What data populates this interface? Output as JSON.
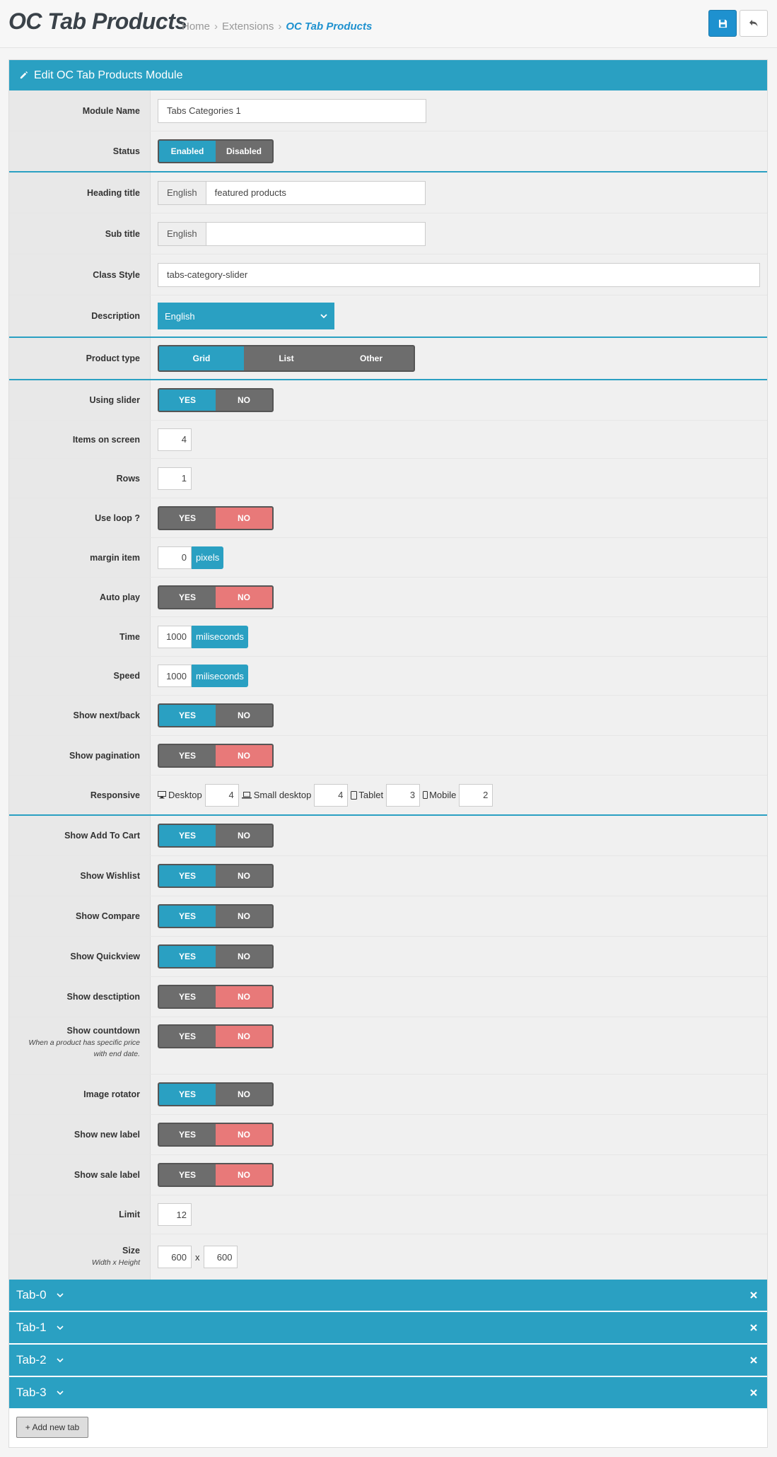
{
  "header": {
    "title": "OC Tab Products",
    "breadcrumb": [
      "Home",
      "Extensions",
      "OC Tab Products"
    ]
  },
  "panel": {
    "title": "Edit OC Tab Products Module"
  },
  "form": {
    "module_name": {
      "label": "Module Name",
      "value": "Tabs Categories 1"
    },
    "status": {
      "label": "Status",
      "on": "Enabled",
      "off": "Disabled"
    },
    "heading_title": {
      "label": "Heading title",
      "lang": "English",
      "value": "featured products"
    },
    "sub_title": {
      "label": "Sub title",
      "lang": "English",
      "value": ""
    },
    "class_style": {
      "label": "Class Style",
      "value": "tabs-category-slider"
    },
    "description": {
      "label": "Description",
      "selected": "English"
    },
    "product_type": {
      "label": "Product type",
      "options": [
        "Grid",
        "List",
        "Other"
      ]
    },
    "using_slider": {
      "label": "Using slider"
    },
    "items_on_screen": {
      "label": "Items on screen",
      "value": "4"
    },
    "rows": {
      "label": "Rows",
      "value": "1"
    },
    "use_loop": {
      "label": "Use loop ?"
    },
    "margin_item": {
      "label": "margin item",
      "value": "0",
      "unit": "pixels"
    },
    "auto_play": {
      "label": "Auto play"
    },
    "time": {
      "label": "Time",
      "value": "1000",
      "unit": "miliseconds"
    },
    "speed": {
      "label": "Speed",
      "value": "1000",
      "unit": "miliseconds"
    },
    "show_next_back": {
      "label": "Show next/back"
    },
    "show_pagination": {
      "label": "Show pagination"
    },
    "responsive": {
      "label": "Responsive",
      "desktop_label": "Desktop",
      "desktop": "4",
      "small_desktop_label": "Small desktop",
      "small_desktop": "4",
      "tablet_label": "Tablet",
      "tablet": "3",
      "mobile_label": "Mobile",
      "mobile": "2"
    },
    "show_add_to_cart": {
      "label": "Show Add To Cart"
    },
    "show_wishlist": {
      "label": "Show Wishlist"
    },
    "show_compare": {
      "label": "Show Compare"
    },
    "show_quickview": {
      "label": "Show Quickview"
    },
    "show_description": {
      "label": "Show desctiption"
    },
    "show_countdown": {
      "label": "Show countdown",
      "hint": "When a product has specific price with end date."
    },
    "image_rotator": {
      "label": "Image rotator"
    },
    "show_new_label": {
      "label": "Show new label"
    },
    "show_sale_label": {
      "label": "Show sale label"
    },
    "limit": {
      "label": "Limit",
      "value": "12"
    },
    "size": {
      "label": "Size",
      "hint": "Width x Height",
      "width": "600",
      "sep": "x",
      "height": "600"
    }
  },
  "toggle": {
    "yes": "YES",
    "no": "NO"
  },
  "tabs": [
    "Tab-0",
    "Tab-1",
    "Tab-2",
    "Tab-3"
  ],
  "add_tab_label": "+ Add new tab",
  "colors": {
    "accent": "#2aa0c2",
    "danger": "#e87979",
    "save_button": "#1e91cf"
  }
}
